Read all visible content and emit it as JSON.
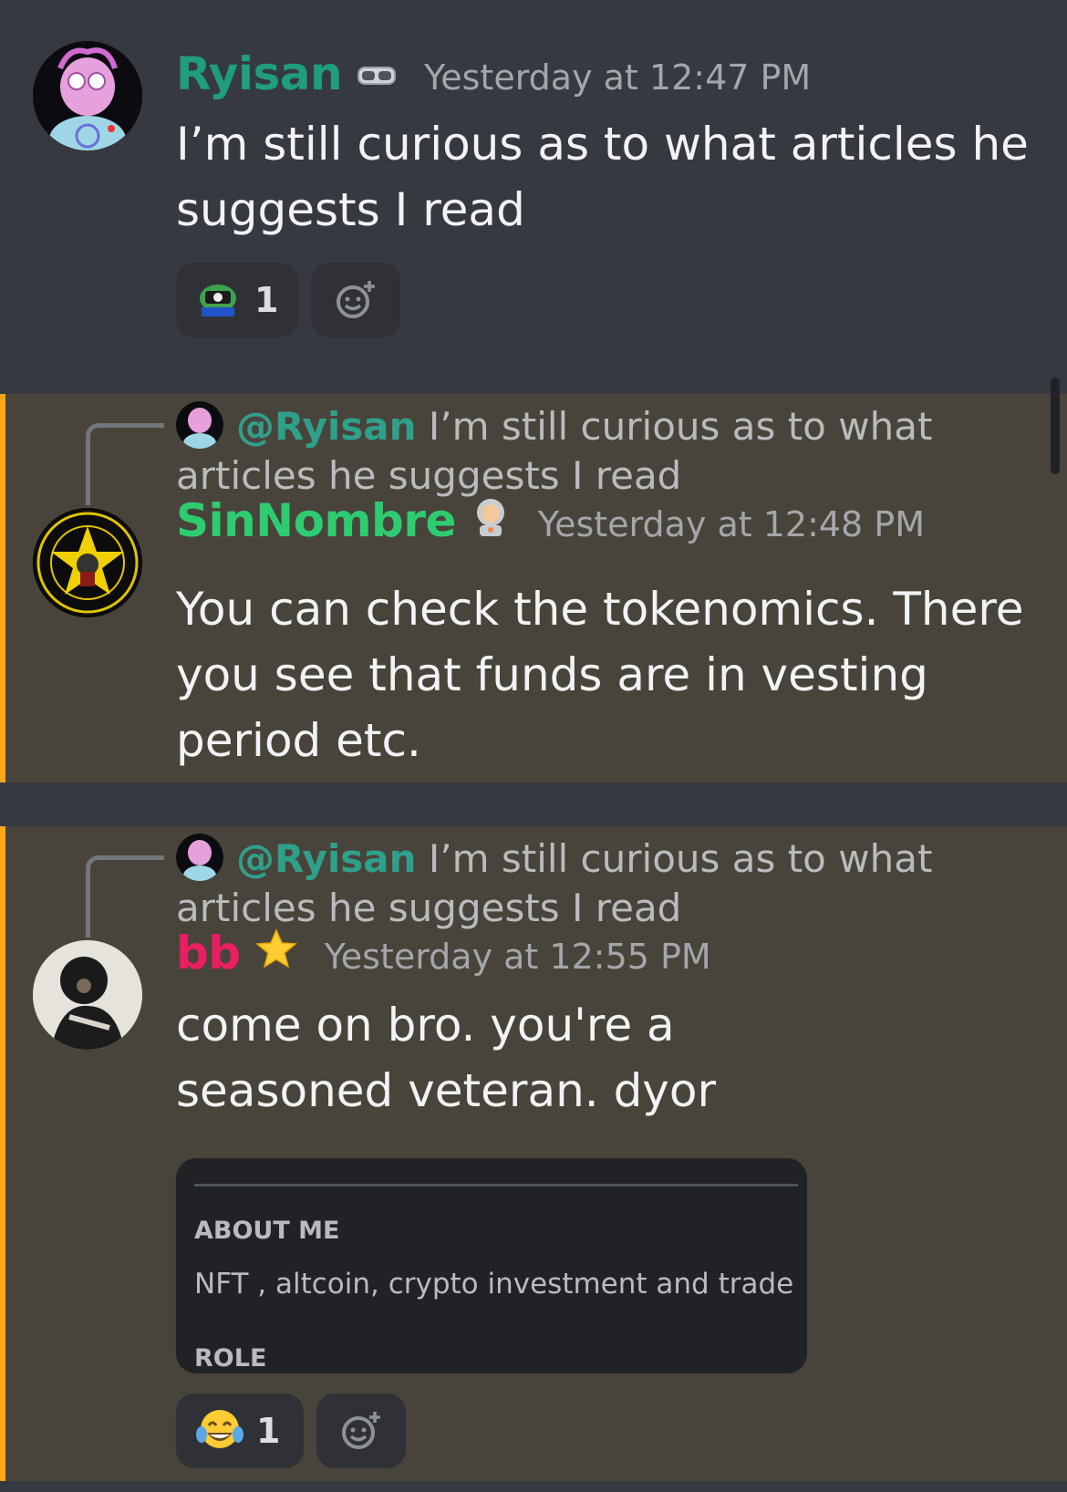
{
  "messages": [
    {
      "username": "Ryisan",
      "username_color": "#1f9d7e",
      "badge_icon": "vr-goggles-icon",
      "timestamp": "Yesterday at 12:47 PM",
      "text": "I’m still curious as to what articles he suggests I read",
      "reactions": [
        {
          "emoji": "pepe-camera-emoji",
          "count": "1"
        }
      ]
    },
    {
      "reply_mention": "@Ryisan",
      "reply_text": "I’m still curious as to what articles he suggests I read",
      "username": "SinNombre",
      "username_color": "#2ecc71",
      "badge_icon": "astronaut-emoji-icon",
      "timestamp": "Yesterday at 12:48 PM",
      "text": "You can check the tokenomics. There you see that funds are in vesting period etc."
    },
    {
      "reply_mention": "@Ryisan",
      "reply_text": "I’m still curious as to what articles he suggests I read",
      "username": "bb",
      "username_color": "#e91e63",
      "badge_icon": "star-icon",
      "timestamp": "Yesterday at 12:55 PM",
      "text": "come on bro. you're a seasoned veteran. dyor",
      "embed": {
        "about_heading": "ABOUT ME",
        "about_text": "NFT , altcoin, crypto investment and trade",
        "role_heading": "ROLE"
      },
      "reactions": [
        {
          "emoji": "tears-of-joy-emoji",
          "count": "1"
        }
      ]
    }
  ],
  "colors": {
    "background": "#36393f",
    "mention_highlight": "#49443b",
    "mention_bar": "#faa61a",
    "reaction_bg": "#2f3136",
    "mention_text": "#2fa08a"
  }
}
